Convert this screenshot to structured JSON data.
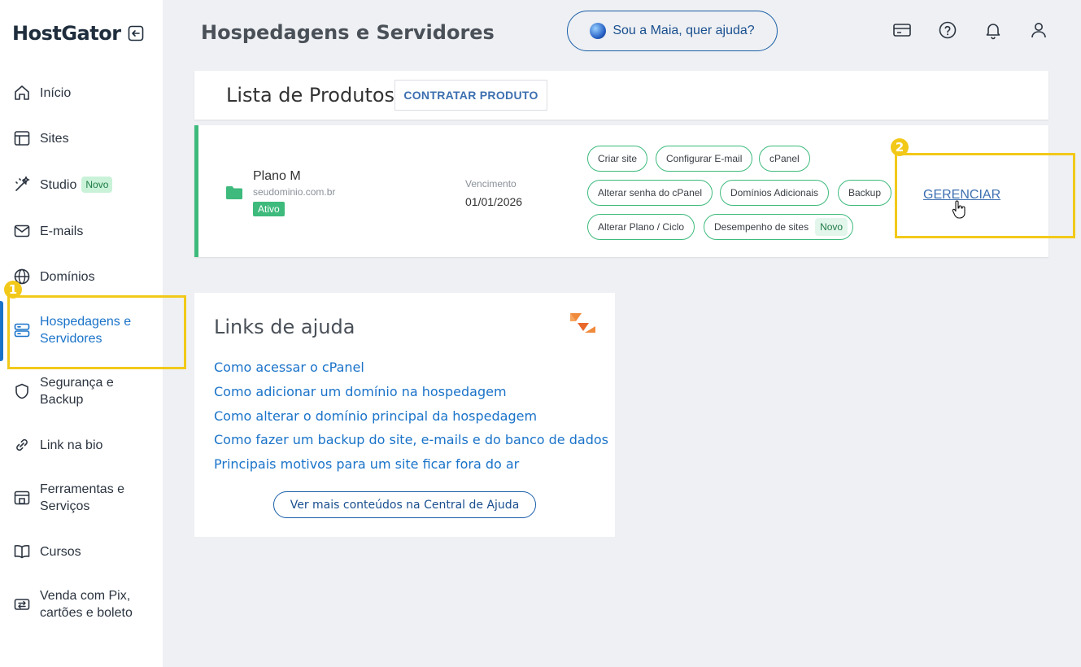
{
  "brand": {
    "name": "HostGator"
  },
  "sidebar": {
    "items": [
      {
        "label": "Início",
        "icon": "home-icon"
      },
      {
        "label": "Sites",
        "icon": "layout-icon"
      },
      {
        "label": "Studio",
        "icon": "wand-icon",
        "badge": "Novo"
      },
      {
        "label": "E-mails",
        "icon": "mail-icon"
      },
      {
        "label": "Domínios",
        "icon": "globe-icon"
      },
      {
        "label": "Hospedagens e Servidores",
        "icon": "server-icon",
        "active": true
      },
      {
        "label": "Segurança e Backup",
        "icon": "shield-icon"
      },
      {
        "label": "Link na bio",
        "icon": "link-icon"
      },
      {
        "label": "Ferramentas e Serviços",
        "icon": "tools-icon"
      },
      {
        "label": "Cursos",
        "icon": "book-icon"
      },
      {
        "label": "Venda com Pix, cartões e boleto",
        "icon": "exchange-icon"
      }
    ]
  },
  "header": {
    "title": "Hospedagens e Servidores",
    "assistant_label": "Sou a Maia, quer ajuda?"
  },
  "annotations": {
    "step1": "1",
    "step2": "2"
  },
  "products": {
    "title": "Lista de Produtos",
    "contract_label": "CONTRATAR PRODUTO",
    "item": {
      "name": "Plano M",
      "domain": "seudominio.com.br",
      "status": "Ativo",
      "due_label": "Vencimento",
      "due_date": "01/01/2026",
      "actions": [
        "Criar site",
        "Configurar E-mail",
        "cPanel",
        "Alterar senha do cPanel",
        "Domínios Adicionais",
        "Backup",
        "Alterar Plano / Ciclo",
        "Desempenho de sites"
      ],
      "new_badge": "Novo",
      "manage_label": "GERENCIAR"
    }
  },
  "help": {
    "title": "Links de ajuda",
    "links": [
      "Como acessar o cPanel",
      "Como adicionar um domínio na hospedagem",
      "Como alterar o domínio principal da hospedagem",
      "Como fazer um backup do site, e-mails e do banco de dados",
      "Principais motivos para um site ficar fora do ar"
    ],
    "more_label": "Ver mais conteúdos na Central de Ajuda"
  },
  "colors": {
    "accent_blue": "#1a73c9",
    "status_green": "#3dba7c",
    "highlight_yellow": "#f2c919",
    "help_logo_orange": "#f08a3c"
  }
}
